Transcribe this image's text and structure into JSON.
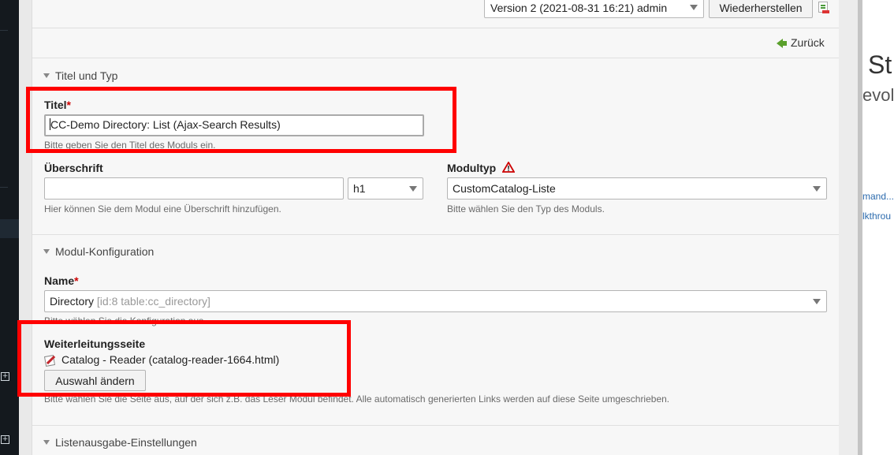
{
  "toolbar": {
    "version_select_value": "Version 2 (2021-08-31 16:21) admin",
    "restore_label": "Wiederherstellen"
  },
  "back_label": "Zurück",
  "sections": {
    "title_type": "Titel und Typ",
    "module_config": "Modul-Konfiguration",
    "list_settings": "Listenausgabe-Einstellungen"
  },
  "fields": {
    "title": {
      "label": "Titel",
      "required_mark": "*",
      "value": "CC-Demo Directory: List (Ajax-Search Results)",
      "help": "Bitte geben Sie den Titel des Moduls ein."
    },
    "headline": {
      "label": "Überschrift",
      "value": "",
      "unit_value": "h1",
      "help": "Hier können Sie dem Modul eine Überschrift hinzufügen."
    },
    "module_type": {
      "label": "Modultyp",
      "value": "CustomCatalog-Liste",
      "help": "Bitte wählen Sie den Typ des Moduls."
    },
    "name": {
      "label": "Name",
      "required_mark": "*",
      "value": "Directory",
      "value_meta": "[id:8 table:cc_directory]",
      "help": "Bitte wählen Sie die Konfiguration aus."
    },
    "redirect": {
      "label": "Weiterleitungsseite",
      "page": "Catalog - Reader (catalog-reader-1664.html)",
      "button_label": "Auswahl ändern",
      "help": "Bitte wählen Sie die Seite aus, auf der sich z.B. das Leser Modul befindet. Alle automatisch generierten Links werden auf diese Seite umgeschrieben."
    }
  },
  "right_preview": {
    "heading": "St",
    "subheading": "evolv",
    "link1": "mand...",
    "link2": "lkthrou"
  },
  "colors": {
    "highlight_box": "#ff0000",
    "back_arrow": "#5aa02c",
    "required": "#cc0000",
    "link": "#2b6aad"
  }
}
